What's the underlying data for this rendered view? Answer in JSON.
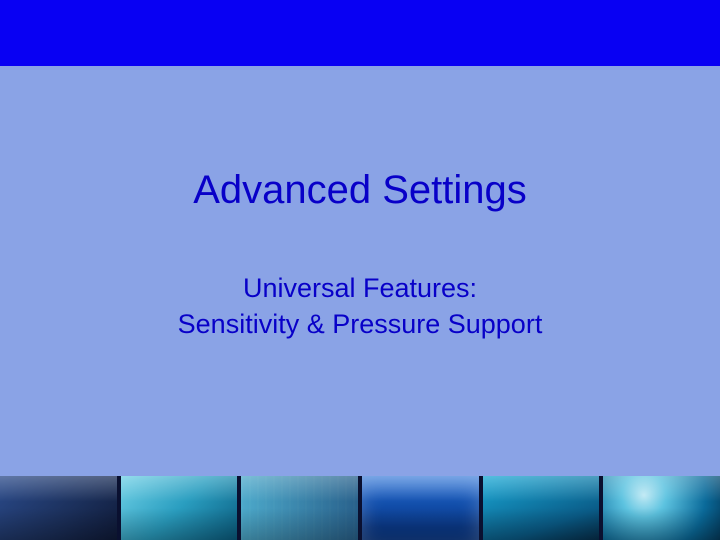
{
  "slide": {
    "title": "Advanced Settings",
    "subtitle_line1": "Universal Features:",
    "subtitle_line2": "Sensitivity & Pressure Support"
  }
}
